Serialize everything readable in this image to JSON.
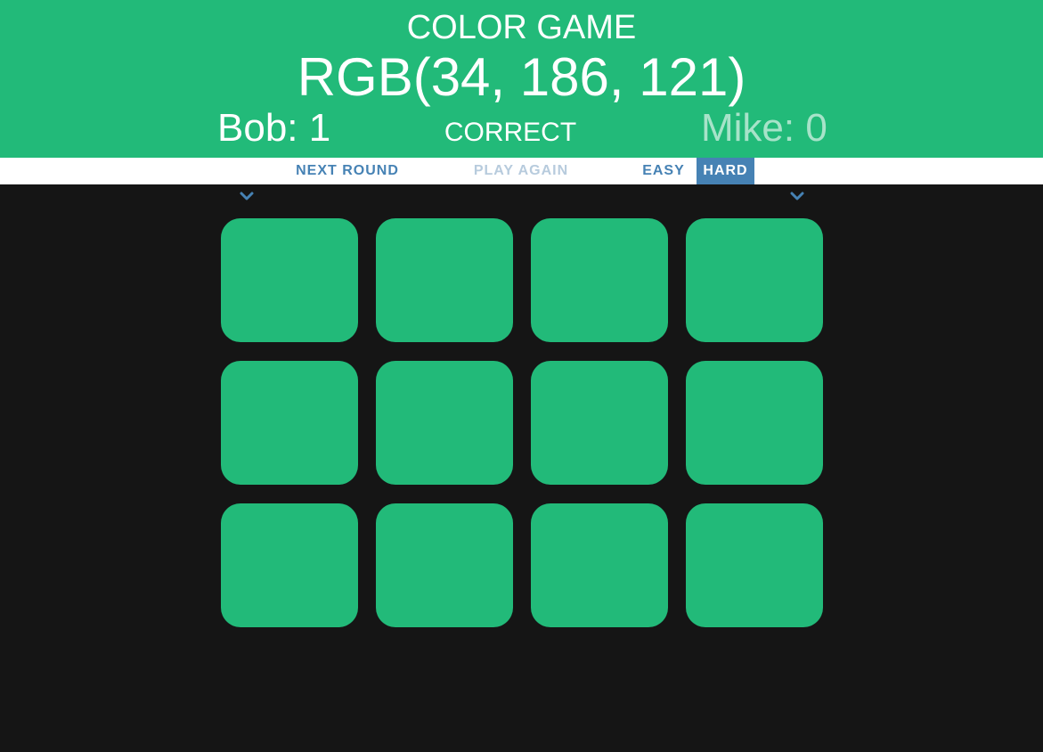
{
  "header": {
    "title": "COLOR GAME",
    "rgb_display": "RGB(34, 186, 121)",
    "background_color": "#22ba79"
  },
  "scores": {
    "player1": "Bob: 1",
    "player2": "Mike: 0"
  },
  "message": "CORRECT",
  "controls": {
    "next_round": "NEXT ROUND",
    "play_again": "PLAY AGAIN",
    "easy": "EASY",
    "hard": "HARD",
    "selected_mode": "HARD",
    "accent_color": "#4682b4"
  },
  "indicators": [
    "chevron-down-icon",
    "chevron-down-icon"
  ],
  "tiles": [
    {
      "color": "#22ba79"
    },
    {
      "color": "#22ba79"
    },
    {
      "color": "#22ba79"
    },
    {
      "color": "#22ba79"
    },
    {
      "color": "#22ba79"
    },
    {
      "color": "#22ba79"
    },
    {
      "color": "#22ba79"
    },
    {
      "color": "#22ba79"
    },
    {
      "color": "#22ba79"
    },
    {
      "color": "#22ba79"
    },
    {
      "color": "#22ba79"
    },
    {
      "color": "#22ba79"
    }
  ],
  "page_background": "#151515"
}
